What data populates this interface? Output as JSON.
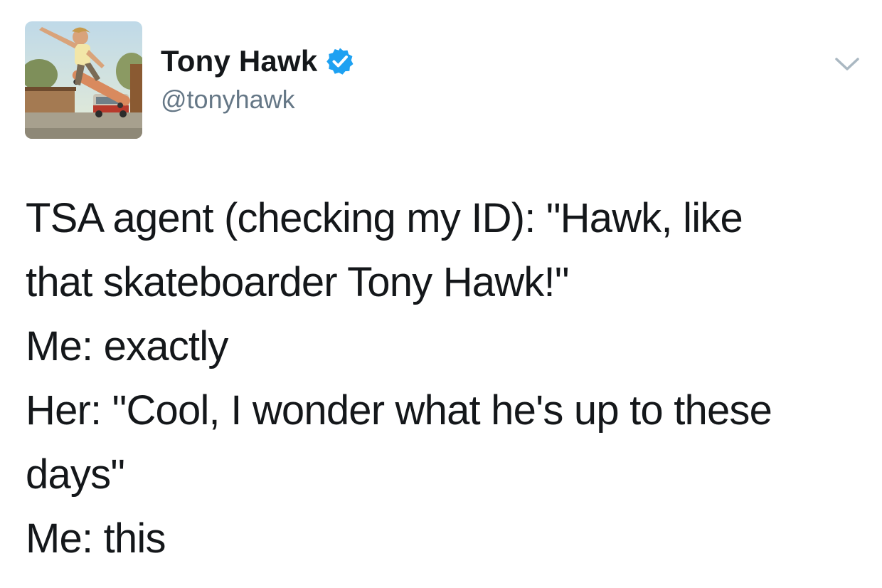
{
  "tweet": {
    "author": {
      "name": "Tony Hawk",
      "handle": "@tonyhawk",
      "verified": true,
      "avatar_icon": "skateboarder-photo"
    },
    "menu_icon": "chevron-down-icon",
    "text_lines": [
      "TSA agent (checking my ID): \"Hawk, like",
      "that skateboarder Tony Hawk!\"",
      "Me: exactly",
      "Her: \"Cool, I wonder what he's up to these",
      "days\"",
      "Me: this"
    ]
  },
  "colors": {
    "text": "#14171a",
    "handle": "#657786",
    "verified_badge": "#1da1f2",
    "chevron": "#aab8c2",
    "background": "#ffffff"
  }
}
